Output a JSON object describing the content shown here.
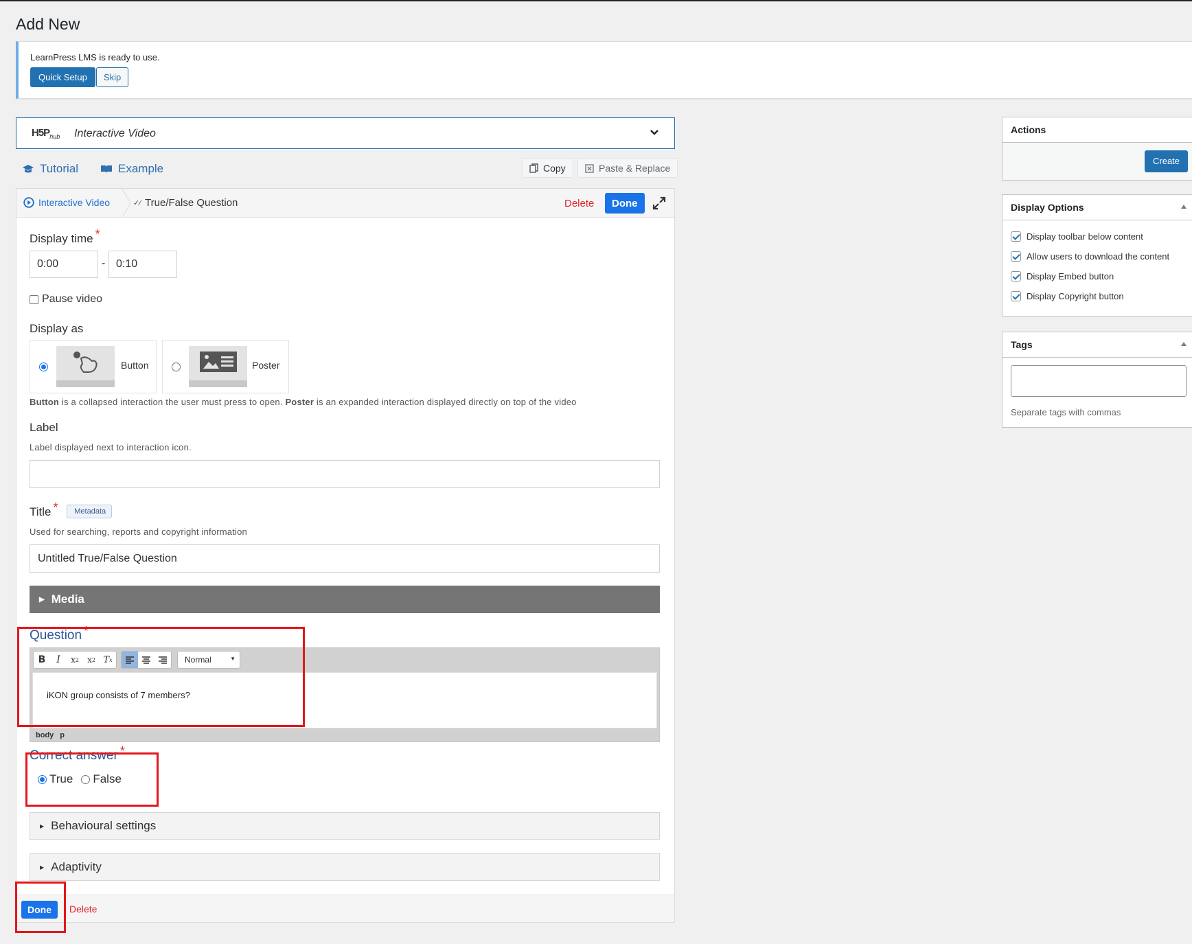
{
  "page": {
    "title": "Add New"
  },
  "notice": {
    "text": "LearnPress LMS is ready to use.",
    "quick_setup": "Quick Setup",
    "skip": "Skip"
  },
  "hub": {
    "logo": "H5P",
    "logo_sub": "hub",
    "content_type": "Interactive Video"
  },
  "tabs": {
    "tutorial": "Tutorial",
    "example": "Example"
  },
  "clipboard": {
    "copy": "Copy",
    "paste": "Paste & Replace"
  },
  "breadcrumb": {
    "root": "Interactive Video",
    "current": "True/False Question",
    "delete": "Delete",
    "done": "Done"
  },
  "display_time": {
    "label": "Display time",
    "from": "0:00",
    "separator": "-",
    "to": "0:10"
  },
  "pause_video": {
    "label": "Pause video",
    "checked": false
  },
  "display_as": {
    "label": "Display as",
    "options": [
      {
        "label": "Button",
        "selected": true
      },
      {
        "label": "Poster",
        "selected": false
      }
    ],
    "desc_strong1": "Button",
    "desc_text1": " is a collapsed interaction the user must press to open. ",
    "desc_strong2": "Poster",
    "desc_text2": " is an expanded interaction displayed directly on top of the video"
  },
  "label_field": {
    "label": "Label",
    "desc": "Label displayed next to interaction icon.",
    "value": ""
  },
  "title_field": {
    "label": "Title",
    "metadata": "Metadata",
    "desc": "Used for searching, reports and copyright information",
    "value": "Untitled True/False Question"
  },
  "media": {
    "label": "Media"
  },
  "question": {
    "label": "Question",
    "format": "Normal",
    "text": "iKON group consists of 7 members?",
    "path": [
      "body",
      "p"
    ]
  },
  "correct_answer": {
    "label": "Correct answer",
    "options": [
      {
        "label": "True",
        "selected": true
      },
      {
        "label": "False",
        "selected": false
      }
    ]
  },
  "sections": {
    "behavioural": "Behavioural settings",
    "adaptivity": "Adaptivity"
  },
  "footer": {
    "done": "Done",
    "delete": "Delete"
  },
  "sidebar": {
    "actions": {
      "title": "Actions",
      "create": "Create"
    },
    "display_options": {
      "title": "Display Options",
      "items": [
        {
          "label": "Display toolbar below content",
          "checked": true
        },
        {
          "label": "Allow users to download the content",
          "checked": true
        },
        {
          "label": "Display Embed button",
          "checked": true
        },
        {
          "label": "Display Copyright button",
          "checked": true
        }
      ]
    },
    "tags": {
      "title": "Tags",
      "hint": "Separate tags with commas"
    }
  },
  "colors": {
    "wp_primary": "#2271b1",
    "h5p_blue": "#1a73e8",
    "danger": "#e0262c",
    "highlight": "#e4161b"
  }
}
